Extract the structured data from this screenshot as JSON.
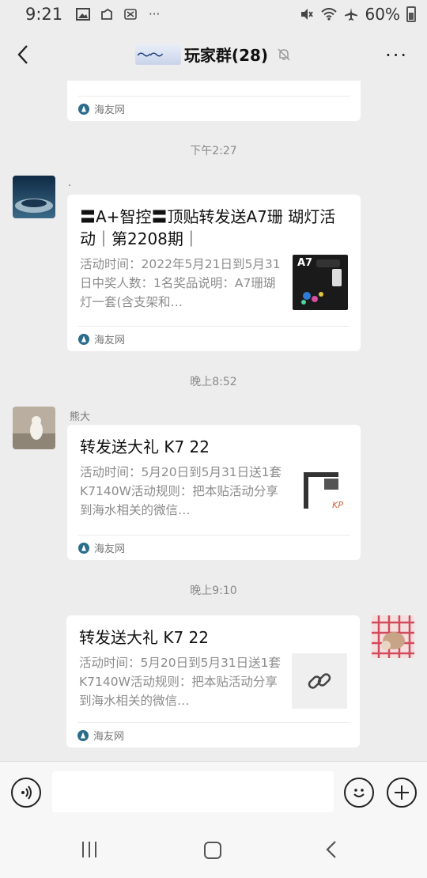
{
  "status_bar": {
    "time": "9:21",
    "battery_text": "60%",
    "icons_left": [
      "image-icon",
      "cloud-icon",
      "network-icon",
      "more-dots-icon"
    ],
    "icons_right": [
      "mute-icon",
      "wifi-icon",
      "airplane-icon",
      "battery-icon"
    ],
    "overflow": "···"
  },
  "header": {
    "title": "玩家群(28)",
    "more": "···"
  },
  "messages": [
    {
      "source": "海友网"
    },
    {
      "timestamp": "下午2:27",
      "sender": ".",
      "title": "〓A+智控〓顶贴转发送A7珊 瑚灯活动｜第2208期｜",
      "desc": "活动时间：2022年5月21日到5月31日中奖人数：1名奖品说明：A7珊瑚灯一套(含支架和…",
      "thumb_label": "A7",
      "source": "海友网"
    },
    {
      "timestamp": "晚上8:52",
      "sender": "熊大",
      "title": "转发送大礼 K7 22",
      "desc": "活动时间：5月20日到5月31日送1套K7140W活动规则：把本贴活动分享到海水相关的微信…",
      "thumb_label": "KP",
      "source": "海友网"
    },
    {
      "timestamp": "晚上9:10",
      "title": "转发送大礼 K7 22",
      "desc": "活动时间：5月20日到5月31日送1套K7140W活动规则：把本贴活动分享到海水相关的微信…",
      "source": "海友网"
    }
  ],
  "input": {
    "placeholder": ""
  },
  "colors": {
    "background": "#ededed",
    "card": "#ffffff",
    "muted_text": "#8c8c8c"
  }
}
